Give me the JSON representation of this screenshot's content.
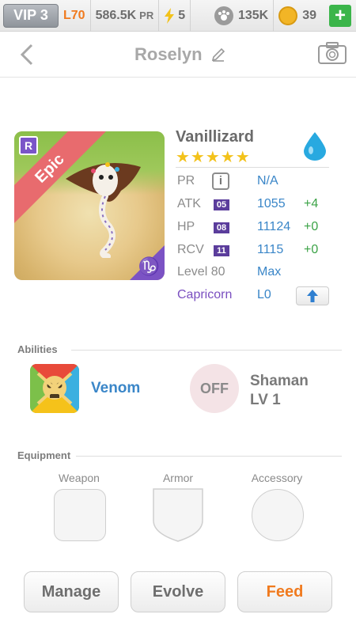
{
  "topbar": {
    "vip": "VIP 3",
    "level": "L70",
    "pr_value": "586.5K",
    "pr_unit": "PR",
    "energy": "5",
    "food": "135K",
    "coins": "39",
    "plus_label": "+"
  },
  "header": {
    "title": "Roselyn"
  },
  "pet": {
    "name": "Vanillizard",
    "rarity": "Epic",
    "stars": "★★★★★",
    "corner_badge": "R",
    "sign_glyph": "♑",
    "element_color": "#28a9e0"
  },
  "stats": {
    "pr_label": "PR",
    "pr_info": "i",
    "pr_value": "N/A",
    "atk_label": "ATK",
    "atk_level": "05",
    "atk_value": "1055",
    "atk_inc": "+4",
    "hp_label": "HP",
    "hp_level": "08",
    "hp_value": "11124",
    "hp_inc": "+0",
    "rcv_label": "RCV",
    "rcv_level": "11",
    "rcv_value": "1115",
    "rcv_inc": "+0",
    "level_label": "Level 80",
    "level_value": "Max",
    "zodiac_label": "Capricorn",
    "zodiac_value": "L0"
  },
  "abilities": {
    "header": "Abilities",
    "ability_name": "Venom",
    "leader_state": "OFF",
    "leader_name": "Shaman",
    "leader_level": "LV 1"
  },
  "equipment": {
    "header": "Equipment",
    "weapon": "Weapon",
    "armor": "Armor",
    "accessory": "Accessory"
  },
  "actions": {
    "manage": "Manage",
    "evolve": "Evolve",
    "feed": "Feed"
  },
  "colors": {
    "accent_orange": "#f07a1e",
    "value_blue": "#3a86c8",
    "increase_green": "#3ca347",
    "epic_purple": "#7b52c4"
  }
}
